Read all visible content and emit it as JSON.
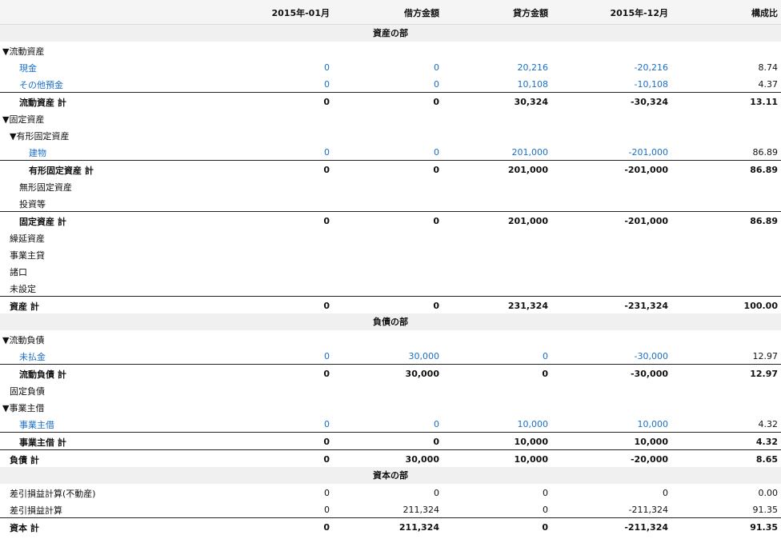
{
  "columns": [
    "2015年-01月",
    "借方金額",
    "貸方金額",
    "2015年-12月",
    "構成比"
  ],
  "sections": {
    "assets": "資産の部",
    "liabilities": "負債の部",
    "capital": "資本の部"
  },
  "rows": [
    {
      "label": "▼流動資産",
      "kind": "group",
      "indent": 0,
      "values": []
    },
    {
      "label": "現金",
      "kind": "acct",
      "indent": 2,
      "values": [
        "0",
        "0",
        "20,216",
        "-20,216",
        "8.74"
      ]
    },
    {
      "label": "その他預金",
      "kind": "acct",
      "indent": 2,
      "values": [
        "0",
        "0",
        "10,108",
        "-10,108",
        "4.37"
      ]
    },
    {
      "label": "流動資産 計",
      "kind": "tot",
      "indent": 2,
      "values": [
        "0",
        "0",
        "30,324",
        "-30,324",
        "13.11"
      ]
    },
    {
      "label": "▼固定資産",
      "kind": "group",
      "indent": 0,
      "values": []
    },
    {
      "label": "▼有形固定資産",
      "kind": "group",
      "indent": 1,
      "values": []
    },
    {
      "label": "建物",
      "kind": "acct",
      "indent": 3,
      "values": [
        "0",
        "0",
        "201,000",
        "-201,000",
        "86.89"
      ]
    },
    {
      "label": "有形固定資産 計",
      "kind": "tot",
      "indent": 3,
      "values": [
        "0",
        "0",
        "201,000",
        "-201,000",
        "86.89"
      ]
    },
    {
      "label": "無形固定資産",
      "kind": "group",
      "indent": 2,
      "values": []
    },
    {
      "label": "投資等",
      "kind": "group",
      "indent": 2,
      "values": []
    },
    {
      "label": "固定資産 計",
      "kind": "tot",
      "indent": 2,
      "values": [
        "0",
        "0",
        "201,000",
        "-201,000",
        "86.89"
      ]
    },
    {
      "label": "繰延資産",
      "kind": "group",
      "indent": 1,
      "values": []
    },
    {
      "label": "事業主貸",
      "kind": "group",
      "indent": 1,
      "values": []
    },
    {
      "label": "諸口",
      "kind": "group",
      "indent": 1,
      "values": []
    },
    {
      "label": "未設定",
      "kind": "group",
      "indent": 1,
      "values": []
    },
    {
      "label": "資産 計",
      "kind": "tot",
      "indent": 1,
      "values": [
        "0",
        "0",
        "231,324",
        "-231,324",
        "100.00"
      ]
    },
    {
      "section": "liabilities"
    },
    {
      "label": "▼流動負債",
      "kind": "group",
      "indent": 0,
      "values": []
    },
    {
      "label": "未払金",
      "kind": "acct",
      "indent": 2,
      "values": [
        "0",
        "30,000",
        "0",
        "-30,000",
        "12.97"
      ]
    },
    {
      "label": "流動負債 計",
      "kind": "tot",
      "indent": 2,
      "values": [
        "0",
        "30,000",
        "0",
        "-30,000",
        "12.97"
      ]
    },
    {
      "label": "固定負債",
      "kind": "group",
      "indent": 1,
      "values": []
    },
    {
      "label": "▼事業主借",
      "kind": "group",
      "indent": 0,
      "values": []
    },
    {
      "label": "事業主借",
      "kind": "acct",
      "indent": 2,
      "values": [
        "0",
        "0",
        "10,000",
        "10,000",
        "4.32"
      ]
    },
    {
      "label": "事業主借 計",
      "kind": "tot",
      "indent": 2,
      "values": [
        "0",
        "0",
        "10,000",
        "10,000",
        "4.32"
      ]
    },
    {
      "label": "負債 計",
      "kind": "tot",
      "indent": 1,
      "values": [
        "0",
        "30,000",
        "10,000",
        "-20,000",
        "8.65"
      ]
    },
    {
      "section": "capital"
    },
    {
      "label": "差引損益計算(不動産)",
      "kind": "plain",
      "indent": 1,
      "values": [
        "0",
        "0",
        "0",
        "0",
        "0.00"
      ]
    },
    {
      "label": "差引損益計算",
      "kind": "plain",
      "indent": 1,
      "values": [
        "0",
        "211,324",
        "0",
        "-211,324",
        "91.35"
      ]
    },
    {
      "label": "資本 計",
      "kind": "tot",
      "indent": 1,
      "values": [
        "0",
        "211,324",
        "0",
        "-211,324",
        "91.35"
      ]
    }
  ],
  "colors": {
    "link": "#1a6fc4",
    "section_bg": "#f0f0f0",
    "header_bg": "#f5f5f5"
  }
}
